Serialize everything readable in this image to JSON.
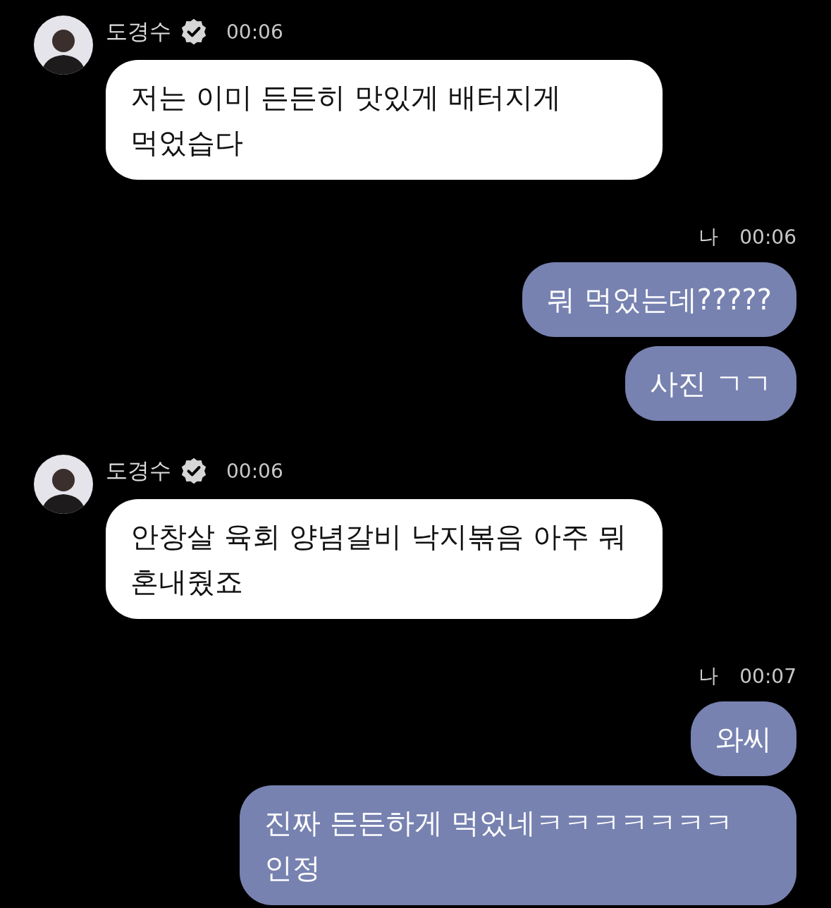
{
  "messages": [
    {
      "kind": "incoming",
      "sender": "도경수",
      "verified": true,
      "time": "00:06",
      "bubbles": [
        "저는 이미 든든히 맛있게 배터지게 먹었습다"
      ]
    },
    {
      "kind": "outgoing",
      "sender": "나",
      "time": "00:06",
      "bubbles": [
        "뭐 먹었는데?????",
        "사진 ㄱㄱ"
      ]
    },
    {
      "kind": "incoming",
      "sender": "도경수",
      "verified": true,
      "time": "00:06",
      "bubbles": [
        "안창살 육회 양념갈비 낙지볶음 아주 뭐 혼내줬죠"
      ]
    },
    {
      "kind": "outgoing",
      "sender": "나",
      "time": "00:07",
      "bubbles": [
        "와씨",
        "진짜 든든하게 먹었네ㅋㅋㅋㅋㅋㅋㅋ 인정"
      ]
    }
  ]
}
